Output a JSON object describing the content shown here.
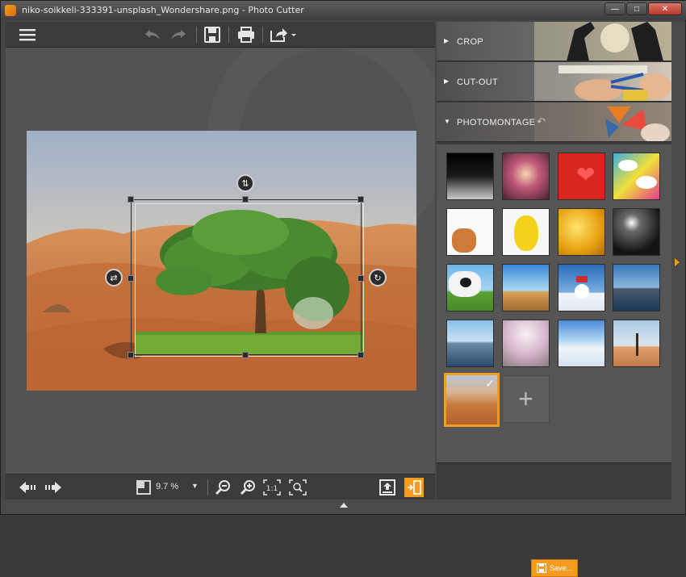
{
  "window": {
    "title": "niko-soikkeli-333391-unsplash_Wondershare.png - Photo Cutter",
    "controls": [
      "minimize",
      "maximize",
      "close"
    ]
  },
  "toolbar": {
    "icons": [
      "menu-icon",
      "undo-icon",
      "redo-icon",
      "save-icon",
      "print-icon",
      "share-icon"
    ]
  },
  "panels": {
    "crop": "CROP",
    "cutout": "CUT-OUT",
    "photomontage": "PHOTOMONTAGE"
  },
  "gallery": {
    "backgrounds": [
      "moon-surface",
      "heart-tree-sunset",
      "red-heart",
      "comic-speech",
      "cats-white",
      "yellow-monster",
      "golden-bokeh",
      "dark-lights",
      "cow",
      "paris-eiffel",
      "snowman",
      "city-skyline",
      "venice-gondolas",
      "cherry-blossom",
      "snowy-forest",
      "desert-tree"
    ],
    "selected": "desert-dunes"
  },
  "save_button": {
    "label": "Save..."
  },
  "zoom": {
    "value": "9.7 %"
  },
  "colors": {
    "accent": "#f39c1f",
    "panel": "#3b3b3b",
    "canvas": "#535353"
  }
}
